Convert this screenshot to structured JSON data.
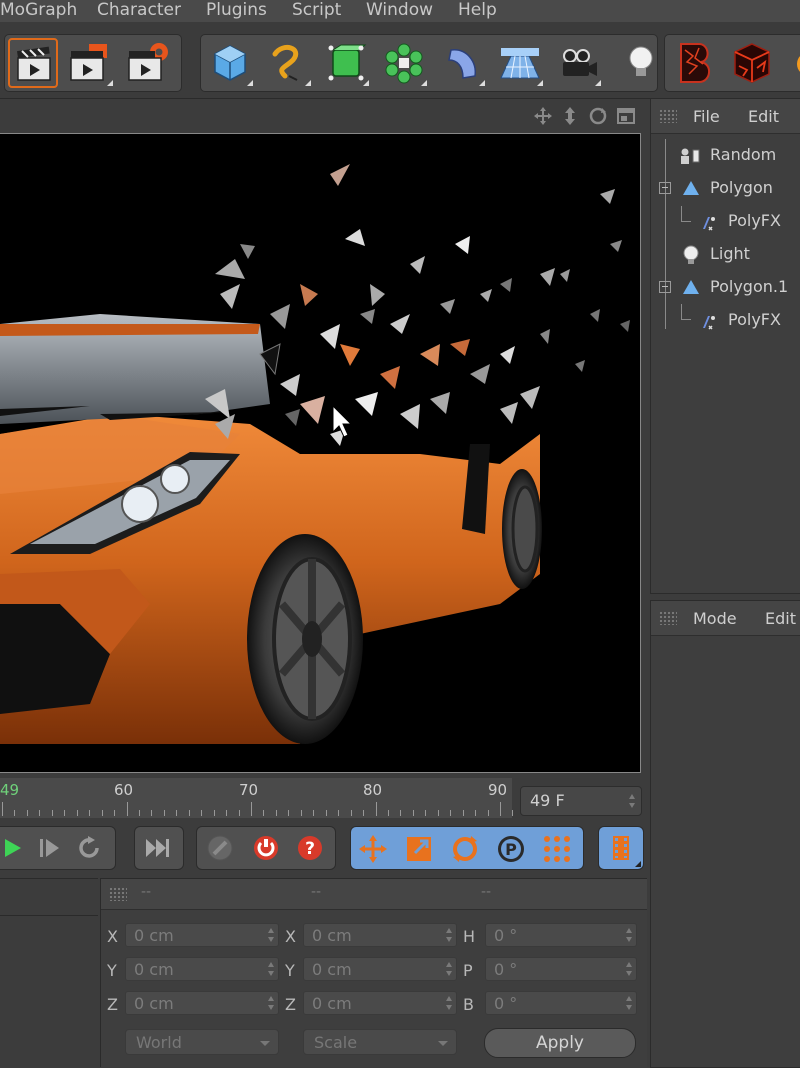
{
  "menu": [
    "MoGraph",
    "Character",
    "Plugins",
    "Script",
    "Window",
    "Help"
  ],
  "object_manager": {
    "menu": [
      "File",
      "Edit"
    ],
    "items": [
      {
        "label": "Random",
        "icon": "random-effector-icon",
        "indent": 0
      },
      {
        "label": "Polygon",
        "icon": "polygon-icon",
        "indent": 0
      },
      {
        "label": "PolyFX",
        "icon": "polyfx-icon",
        "indent": 1
      },
      {
        "label": "Light",
        "icon": "light-bulb-icon",
        "indent": 0
      },
      {
        "label": "Polygon.1",
        "icon": "polygon-icon",
        "indent": 0
      },
      {
        "label": "PolyFX",
        "icon": "polyfx-icon",
        "indent": 1
      }
    ]
  },
  "attribute_manager": {
    "menu": [
      "Mode",
      "Edit"
    ]
  },
  "timeline": {
    "current_label": "49",
    "ticks": [
      "60",
      "70",
      "80",
      "90"
    ],
    "current_frame_field": "49 F"
  },
  "coordinates": {
    "header_dashes": [
      "--",
      "--",
      "--"
    ],
    "col1": [
      {
        "axis": "X",
        "value": "0 cm"
      },
      {
        "axis": "Y",
        "value": "0 cm"
      },
      {
        "axis": "Z",
        "value": "0 cm"
      }
    ],
    "col2": [
      {
        "axis": "X",
        "value": "0 cm"
      },
      {
        "axis": "Y",
        "value": "0 cm"
      },
      {
        "axis": "Z",
        "value": "0 cm"
      }
    ],
    "col3": [
      {
        "axis": "H",
        "value": "0 °"
      },
      {
        "axis": "P",
        "value": "0 °"
      },
      {
        "axis": "B",
        "value": "0 °"
      }
    ],
    "mode_dropdown": "World",
    "size_dropdown": "Scale",
    "apply_label": "Apply"
  },
  "colors": {
    "accent_orange": "#e06a1a",
    "car_orange": "#d0651c",
    "active_blue": "#6f9fd8"
  }
}
